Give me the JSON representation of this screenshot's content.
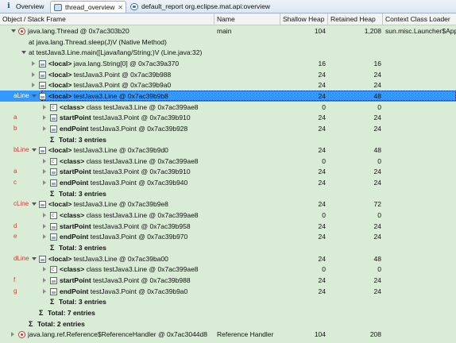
{
  "tabs": [
    {
      "label": "Overview",
      "icon": "info-icon"
    },
    {
      "label": "thread_overview",
      "icon": "thread-icon",
      "active": true,
      "close": "✕"
    },
    {
      "label": "default_report  org.eclipse.mat.api:overview",
      "icon": "report-icon"
    }
  ],
  "columns": [
    "Object / Stack Frame",
    "Name",
    "Shallow Heap",
    "Retained Heap",
    "Context Class Loader"
  ],
  "rows": [
    {
      "indent": 0,
      "twisty": "expanded",
      "icon": "thread",
      "marker": "",
      "bold": "",
      "text": "java.lang.Thread @ 0x7ac303b20",
      "name": "main",
      "shallow": "104",
      "retained": "1,208",
      "ctx": "sun.misc.Launcher$App"
    },
    {
      "indent": 1,
      "twisty": "",
      "icon": "",
      "marker": "",
      "bold": "",
      "text": "at java.lang.Thread.sleep(J)V (Native Method)",
      "name": "",
      "shallow": "",
      "retained": "",
      "ctx": ""
    },
    {
      "indent": 1,
      "twisty": "expanded",
      "icon": "",
      "marker": "",
      "bold": "",
      "text": "at testJava3.Line.main([Ljava/lang/String;)V (Line.java:32)",
      "name": "",
      "shallow": "",
      "retained": "",
      "ctx": ""
    },
    {
      "indent": 2,
      "twisty": "collapsed",
      "icon": "obj",
      "marker": "",
      "bold": "<local>",
      "text": "java.lang.String[0] @ 0x7ac39a370",
      "name": "",
      "shallow": "16",
      "retained": "16",
      "ctx": ""
    },
    {
      "indent": 2,
      "twisty": "collapsed",
      "icon": "obj",
      "marker": "",
      "bold": "<local>",
      "text": "testJava3.Point @ 0x7ac39b988",
      "name": "",
      "shallow": "24",
      "retained": "24",
      "ctx": ""
    },
    {
      "indent": 2,
      "twisty": "collapsed",
      "icon": "obj",
      "marker": "",
      "bold": "<local>",
      "text": "testJava3.Point @ 0x7ac39b9a0",
      "name": "",
      "shallow": "24",
      "retained": "24",
      "ctx": ""
    },
    {
      "indent": 2,
      "twisty": "expanded",
      "icon": "obj",
      "marker": "aLine",
      "bold": "<local>",
      "text": "testJava3.Line @ 0x7ac39b9b8",
      "name": "",
      "shallow": "24",
      "retained": "48",
      "ctx": "",
      "selected": true
    },
    {
      "indent": 3,
      "twisty": "collapsed",
      "icon": "class",
      "marker": "",
      "bold": "<class>",
      "text": "class testJava3.Line @ 0x7ac399ae8",
      "name": "",
      "shallow": "0",
      "retained": "0",
      "ctx": ""
    },
    {
      "indent": 3,
      "twisty": "collapsed",
      "icon": "obj",
      "marker": "a",
      "bold": "startPoint",
      "text": "testJava3.Point @ 0x7ac39b910",
      "name": "",
      "shallow": "24",
      "retained": "24",
      "ctx": ""
    },
    {
      "indent": 3,
      "twisty": "collapsed",
      "icon": "obj",
      "marker": "b",
      "bold": "endPoint",
      "text": "testJava3.Point @ 0x7ac39b928",
      "name": "",
      "shallow": "24",
      "retained": "24",
      "ctx": ""
    },
    {
      "indent": 3,
      "twisty": "",
      "icon": "sigma",
      "marker": "",
      "bold": "Total: 3 entries",
      "text": "",
      "name": "",
      "shallow": "",
      "retained": "",
      "ctx": ""
    },
    {
      "indent": 2,
      "twisty": "expanded",
      "icon": "obj",
      "marker": "bLine",
      "bold": "<local>",
      "text": "testJava3.Line @ 0x7ac39b9d0",
      "name": "",
      "shallow": "24",
      "retained": "48",
      "ctx": ""
    },
    {
      "indent": 3,
      "twisty": "collapsed",
      "icon": "class",
      "marker": "",
      "bold": "<class>",
      "text": "class testJava3.Line @ 0x7ac399ae8",
      "name": "",
      "shallow": "0",
      "retained": "0",
      "ctx": ""
    },
    {
      "indent": 3,
      "twisty": "collapsed",
      "icon": "obj",
      "marker": "a",
      "bold": "startPoint",
      "text": "testJava3.Point @ 0x7ac39b910",
      "name": "",
      "shallow": "24",
      "retained": "24",
      "ctx": ""
    },
    {
      "indent": 3,
      "twisty": "collapsed",
      "icon": "obj",
      "marker": "c",
      "bold": "endPoint",
      "text": "testJava3.Point @ 0x7ac39b940",
      "name": "",
      "shallow": "24",
      "retained": "24",
      "ctx": ""
    },
    {
      "indent": 3,
      "twisty": "",
      "icon": "sigma",
      "marker": "",
      "bold": "Total: 3 entries",
      "text": "",
      "name": "",
      "shallow": "",
      "retained": "",
      "ctx": ""
    },
    {
      "indent": 2,
      "twisty": "expanded",
      "icon": "obj",
      "marker": "cLine",
      "bold": "<local>",
      "text": "testJava3.Line @ 0x7ac39b9e8",
      "name": "",
      "shallow": "24",
      "retained": "72",
      "ctx": ""
    },
    {
      "indent": 3,
      "twisty": "collapsed",
      "icon": "class",
      "marker": "",
      "bold": "<class>",
      "text": "class testJava3.Line @ 0x7ac399ae8",
      "name": "",
      "shallow": "0",
      "retained": "0",
      "ctx": ""
    },
    {
      "indent": 3,
      "twisty": "collapsed",
      "icon": "obj",
      "marker": "d",
      "bold": "startPoint",
      "text": "testJava3.Point @ 0x7ac39b958",
      "name": "",
      "shallow": "24",
      "retained": "24",
      "ctx": ""
    },
    {
      "indent": 3,
      "twisty": "collapsed",
      "icon": "obj",
      "marker": "e",
      "bold": "endPoint",
      "text": "testJava3.Point @ 0x7ac39b970",
      "name": "",
      "shallow": "24",
      "retained": "24",
      "ctx": ""
    },
    {
      "indent": 3,
      "twisty": "",
      "icon": "sigma",
      "marker": "",
      "bold": "Total: 3 entries",
      "text": "",
      "name": "",
      "shallow": "",
      "retained": "",
      "ctx": ""
    },
    {
      "indent": 2,
      "twisty": "expanded",
      "icon": "obj",
      "marker": "dLine",
      "bold": "<local>",
      "text": "testJava3.Line @ 0x7ac39ba00",
      "name": "",
      "shallow": "24",
      "retained": "48",
      "ctx": ""
    },
    {
      "indent": 3,
      "twisty": "collapsed",
      "icon": "class",
      "marker": "",
      "bold": "<class>",
      "text": "class testJava3.Line @ 0x7ac399ae8",
      "name": "",
      "shallow": "0",
      "retained": "0",
      "ctx": ""
    },
    {
      "indent": 3,
      "twisty": "collapsed",
      "icon": "obj",
      "marker": "f",
      "bold": "startPoint",
      "text": "testJava3.Point @ 0x7ac39b988",
      "name": "",
      "shallow": "24",
      "retained": "24",
      "ctx": ""
    },
    {
      "indent": 3,
      "twisty": "collapsed",
      "icon": "obj",
      "marker": "g",
      "bold": "endPoint",
      "text": "testJava3.Point @ 0x7ac39b9a0",
      "name": "",
      "shallow": "24",
      "retained": "24",
      "ctx": ""
    },
    {
      "indent": 3,
      "twisty": "",
      "icon": "sigma",
      "marker": "",
      "bold": "Total: 3 entries",
      "text": "",
      "name": "",
      "shallow": "",
      "retained": "",
      "ctx": ""
    },
    {
      "indent": 2,
      "twisty": "",
      "icon": "sigma",
      "marker": "",
      "bold": "Total: 7 entries",
      "text": "",
      "name": "",
      "shallow": "",
      "retained": "",
      "ctx": ""
    },
    {
      "indent": 1,
      "twisty": "",
      "icon": "sigma",
      "marker": "",
      "bold": "Total: 2 entries",
      "text": "",
      "name": "",
      "shallow": "",
      "retained": "",
      "ctx": ""
    },
    {
      "indent": 0,
      "twisty": "collapsed",
      "icon": "thread",
      "marker": "",
      "bold": "",
      "text": "java.lang.ref.Reference$ReferenceHandler @ 0x7ac3044d8",
      "name": "Reference Handler",
      "shallow": "104",
      "retained": "208",
      "ctx": ""
    }
  ]
}
